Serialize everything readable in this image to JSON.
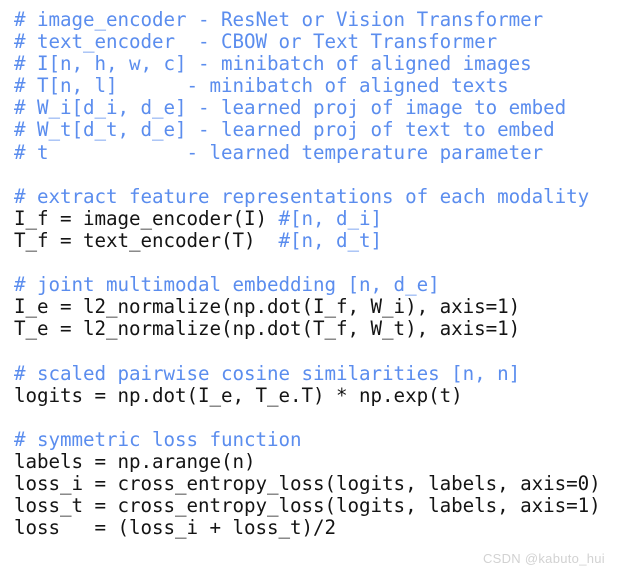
{
  "figure": {
    "kind": "code-snippet",
    "language": "python-pseudocode",
    "background_color": "#ffffff",
    "comment_color": "#5b8dee",
    "code_color": "#141414",
    "watermark_color": "#d2d2d2"
  },
  "watermark": {
    "text": "CSDN @kabuto_hui"
  },
  "code": {
    "lines": [
      {
        "type": "comment",
        "text": "# image_encoder - ResNet or Vision Transformer"
      },
      {
        "type": "comment",
        "text": "# text_encoder  - CBOW or Text Transformer"
      },
      {
        "type": "comment",
        "text": "# I[n, h, w, c] - minibatch of aligned images"
      },
      {
        "type": "comment",
        "text": "# T[n, l]      - minibatch of aligned texts"
      },
      {
        "type": "comment",
        "text": "# W_i[d_i, d_e] - learned proj of image to embed"
      },
      {
        "type": "comment",
        "text": "# W_t[d_t, d_e] - learned proj of text to embed"
      },
      {
        "type": "comment",
        "text": "# t            - learned temperature parameter"
      },
      {
        "type": "blank",
        "text": ""
      },
      {
        "type": "comment",
        "text": "# extract feature representations of each modality"
      },
      {
        "type": "mixed",
        "code": "I_f = image_encoder(I) ",
        "comment": "#[n, d_i]"
      },
      {
        "type": "mixed",
        "code": "T_f = text_encoder(T)  ",
        "comment": "#[n, d_t]"
      },
      {
        "type": "blank",
        "text": ""
      },
      {
        "type": "comment",
        "text": "# joint multimodal embedding [n, d_e]"
      },
      {
        "type": "code",
        "text": "I_e = l2_normalize(np.dot(I_f, W_i), axis=1)"
      },
      {
        "type": "code",
        "text": "T_e = l2_normalize(np.dot(T_f, W_t), axis=1)"
      },
      {
        "type": "blank",
        "text": ""
      },
      {
        "type": "comment",
        "text": "# scaled pairwise cosine similarities [n, n]"
      },
      {
        "type": "code",
        "text": "logits = np.dot(I_e, T_e.T) * np.exp(t)"
      },
      {
        "type": "blank",
        "text": ""
      },
      {
        "type": "comment",
        "text": "# symmetric loss function"
      },
      {
        "type": "code",
        "text": "labels = np.arange(n)"
      },
      {
        "type": "code",
        "text": "loss_i = cross_entropy_loss(logits, labels, axis=0)"
      },
      {
        "type": "code",
        "text": "loss_t = cross_entropy_loss(logits, labels, axis=1)"
      },
      {
        "type": "code",
        "text": "loss   = (loss_i + loss_t)/2"
      }
    ]
  }
}
